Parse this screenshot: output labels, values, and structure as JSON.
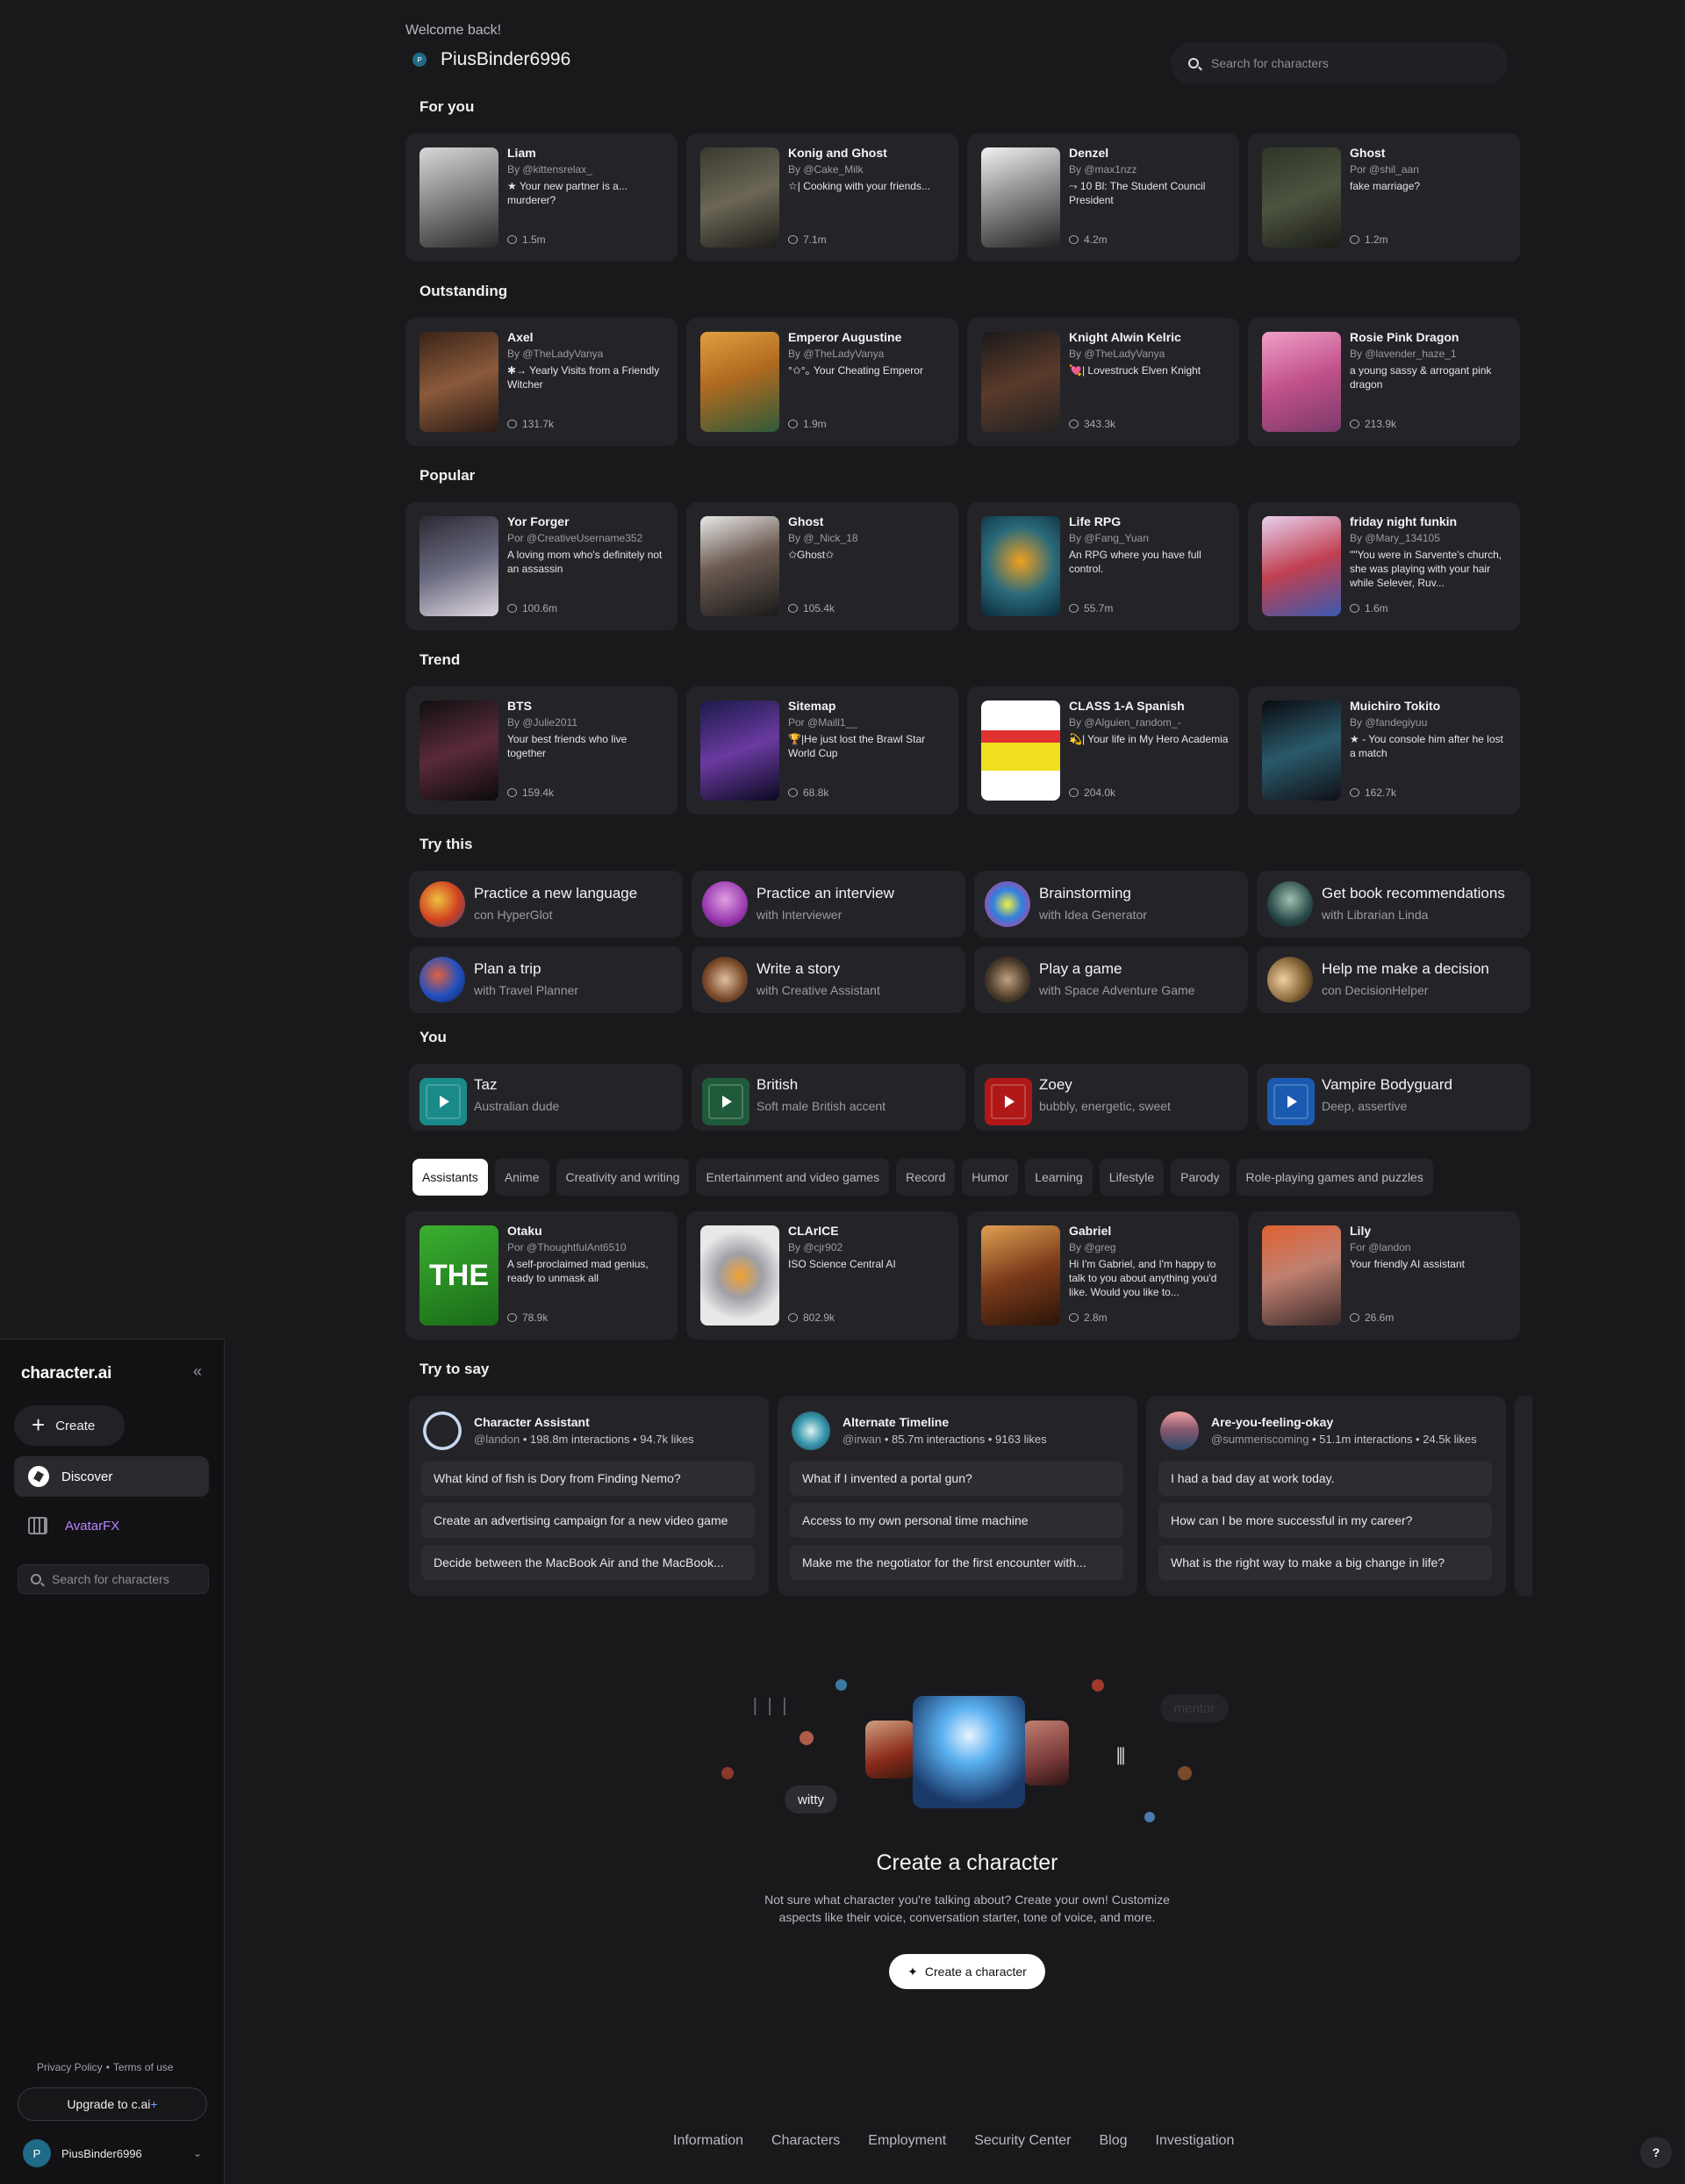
{
  "sidebar": {
    "logo": "character.ai",
    "collapse_icon": "«",
    "create_label": "Create",
    "nav": {
      "discover": "Discover",
      "avatarfx": "AvatarFX"
    },
    "search_placeholder": "Search for characters",
    "privacy": "Privacy Policy",
    "separator": "•",
    "terms": "Terms of use",
    "upgrade_prefix": "Upgrade to c.ai",
    "upgrade_plus": "+",
    "user_initial": "P",
    "user_name": "PiusBinder6996"
  },
  "header": {
    "welcome": "Welcome back!",
    "user_initial": "P",
    "user_name": "PiusBinder6996",
    "search_placeholder": "Search for characters"
  },
  "sections": {
    "for_you": {
      "title": "For you",
      "cards": [
        {
          "name": "Liam",
          "by": "By @kittensrelax_",
          "desc": "★ Your new partner is a... murderer?",
          "count": "1.5m",
          "thumb": "linear-gradient(160deg,#d8d8d8,#8a8a8a 45%,#2a2a2a)"
        },
        {
          "name": "Konig and Ghost",
          "by": "By @Cake_Milk",
          "desc": "☆| Cooking with your friends...",
          "count": "7.1m",
          "thumb": "linear-gradient(160deg,#3a3a30,#6b6656 50%,#1d1c18)"
        },
        {
          "name": "Denzel",
          "by": "By @max1nzz",
          "desc": "⤳ 10 Bl: The Student Council President",
          "count": "4.2m",
          "thumb": "linear-gradient(160deg,#f2f2f2,#9a9a9a 40%,#222)"
        },
        {
          "name": "Ghost",
          "by": "Por @shil_aan",
          "desc": "fake marriage?",
          "count": "1.2m",
          "thumb": "linear-gradient(160deg,#2f3528,#4d5340 50%,#1a1d16)"
        }
      ]
    },
    "outstanding": {
      "title": "Outstanding",
      "cards": [
        {
          "name": "Axel",
          "by": "By @TheLadyVanya",
          "desc": "✱→ Yearly Visits from a Friendly Witcher",
          "count": "131.7k",
          "thumb": "linear-gradient(160deg,#3a2418,#8a5a3a 50%,#2a1a14)"
        },
        {
          "name": "Emperor Augustine",
          "by": "By @TheLadyVanya",
          "desc": "°✩°｡ Your Cheating Emperor",
          "count": "1.9m",
          "thumb": "linear-gradient(160deg,#e0a040,#b06a20 45%,#2f5a3a)"
        },
        {
          "name": "Knight Alwin Kelric",
          "by": "By @TheLadyVanya",
          "desc": "💘| Lovestruck Elven Knight",
          "count": "343.3k",
          "thumb": "linear-gradient(160deg,#1a1a1a,#5a3a2a 50%,#222)"
        },
        {
          "name": "Rosie Pink Dragon",
          "by": "By @lavender_haze_1",
          "desc": "a young sassy & arrogant pink dragon",
          "count": "213.9k",
          "thumb": "linear-gradient(160deg,#f0a0c8,#c0508a 50%,#7a3a6a)"
        }
      ]
    },
    "popular": {
      "title": "Popular",
      "cards": [
        {
          "name": "Yor Forger",
          "by": "Por @CreativeUsername352",
          "desc": "A loving mom who's definitely not an assassin",
          "count": "100.6m",
          "thumb": "linear-gradient(160deg,#2a2a34,#6a6a80 50%,#e0d8e0)"
        },
        {
          "name": "Ghost",
          "by": "By @_Nick_18",
          "desc": "✩Ghost✩",
          "count": "105.4k",
          "thumb": "linear-gradient(160deg,#e8e8e8,#6a5a50 45%,#1a1a1a)"
        },
        {
          "name": "Life RPG",
          "by": "By @Fang_Yuan",
          "desc": "An RPG where you have full control.",
          "count": "55.7m",
          "thumb": "radial-gradient(circle at 50% 45%,#f0a020,#2a6a7a 50%,#0a2a3a)"
        },
        {
          "name": "friday night funkin",
          "by": "By @Mary_134105",
          "desc": "\"\"You were in Sarvente's church, she was playing with your hair while Selever, Ruv...",
          "count": "1.6m",
          "thumb": "linear-gradient(160deg,#e8d0f0,#c04050 50%,#3a5ab0)"
        }
      ]
    },
    "trend": {
      "title": "Trend",
      "cards": [
        {
          "name": "BTS",
          "by": "By @Julie2011",
          "desc": "Your best friends who live together",
          "count": "159.4k",
          "thumb": "linear-gradient(160deg,#101010,#5a2a3a 50%,#0a0a0a)"
        },
        {
          "name": "Sitemap",
          "by": "Por @Maill1__",
          "desc": "🏆|He just lost the Brawl Star World Cup",
          "count": "68.8k",
          "thumb": "linear-gradient(160deg,#1a1a4a,#6a3aa0 50%,#0a0a20)"
        },
        {
          "name": "CLASS 1-A Spanish",
          "by": "By @Alguien_random_-",
          "desc": "💫| Your life in My Hero Academia",
          "count": "204.0k",
          "thumb": "linear-gradient(180deg,#fff 0 30%,#e03030 30% 42%,#f0e020 42% 70%,#fff 70%)"
        },
        {
          "name": "Muichiro Tokito",
          "by": "By @fandegiyuu",
          "desc": "★ - You console him after he lost a match",
          "count": "162.7k",
          "thumb": "linear-gradient(160deg,#0a0a10,#2a5a6a 50%,#101018)"
        }
      ]
    },
    "try_this": {
      "title": "Try this",
      "items": [
        {
          "t1": "Practice a new language",
          "t2": "con HyperGlot",
          "bg": "radial-gradient(circle at 40% 40%,#f0c040,#d04020 55%,#2a4a8a)"
        },
        {
          "t1": "Practice an interview",
          "t2": "with Interviewer",
          "bg": "radial-gradient(circle at 50% 40%,#e0a0e0,#9a3ab0 60%,#3a1a4a)"
        },
        {
          "t1": "Brainstorming",
          "t2": "with Idea Generator",
          "bg": "radial-gradient(circle at 50% 50%,#f0f040,#3080e0 45%,#e03080)"
        },
        {
          "t1": "Get book recommendations",
          "t2": "with Librarian Linda",
          "bg": "radial-gradient(circle at 50% 40%,#a0c0b0,#2a4a4a 60%,#101818)"
        },
        {
          "t1": "Plan a trip",
          "t2": "with Travel Planner",
          "bg": "radial-gradient(circle at 40% 40%,#e06040,#2050c0 55%,#102050)"
        },
        {
          "t1": "Write a story",
          "t2": "with Creative Assistant",
          "bg": "radial-gradient(circle at 50% 50%,#e0c0a0,#7a4a2a 60%,#2a1a10)"
        },
        {
          "t1": "Play a game",
          "t2": "with Space Adventure Game",
          "bg": "radial-gradient(circle at 50% 50%,#c0a080,#4a3a2a 60%,#1a1410)"
        },
        {
          "t1": "Help me make a decision",
          "t2": "con DecisionHelper",
          "bg": "radial-gradient(circle at 35% 50%,#f0d0a0,#8a6a3a 55%,#1a1410)"
        }
      ]
    },
    "you": {
      "title": "You",
      "voices": [
        {
          "t1": "Taz",
          "t2": "Australian dude",
          "color": "#1a8a8a"
        },
        {
          "t1": "British",
          "t2": "Soft male British accent",
          "color": "#1f5a3a"
        },
        {
          "t1": "Zoey",
          "t2": "bubbly, energetic, sweet",
          "color": "#b01818"
        },
        {
          "t1": "Vampire Bodyguard",
          "t2": "Deep, assertive",
          "color": "#1a5ab0"
        }
      ]
    },
    "tags": [
      "Assistants",
      "Anime",
      "Creativity and writing",
      "Entertainment and video games",
      "Record",
      "Humor",
      "Learning",
      "Lifestyle",
      "Parody",
      "Role-playing games and puzzles"
    ],
    "assistants": {
      "cards": [
        {
          "name": "Otaku",
          "by": "Por @ThoughtfulAnt6510",
          "desc": "A self-proclaimed mad genius, ready to unmask all",
          "count": "78.9k",
          "thumb": "linear-gradient(160deg,#3ab030,#1a6a18)",
          "thumb_text": "THE"
        },
        {
          "name": "CLArICE",
          "by": "By @cjr902",
          "desc": "ISO Science Central AI",
          "count": "802.9k",
          "thumb": "radial-gradient(circle at 50% 50%,#f0a030,#a0a0a8 35%,#e8e8e8 70%)"
        },
        {
          "name": "Gabriel",
          "by": "By @greg",
          "desc": "Hi I'm Gabriel, and I'm happy to talk to you about anything you'd like. Would you like to...",
          "count": "2.8m",
          "thumb": "linear-gradient(160deg,#e0a050,#7a3a1a 50%,#2a1408)"
        },
        {
          "name": "Lily",
          "by": "For @landon",
          "desc": "Your friendly AI assistant",
          "count": "26.6m",
          "thumb": "linear-gradient(160deg,#e06030,#c08070 45%,#3a2a2a)"
        }
      ]
    },
    "try_to_say": {
      "title": "Try to say",
      "cards": [
        {
          "name": "Character Assistant",
          "handle": "@landon",
          "stats": " • 198.8m interactions • 94.7k likes",
          "avatar": "radial-gradient(circle,#242428 58%,#c8d8f0 60%,#c8d8f0 70%,#242428 72%)",
          "qs": [
            "What kind of fish is Dory from Finding Nemo?",
            "Create an advertising campaign for a new video game",
            "Decide between the MacBook Air and the MacBook..."
          ]
        },
        {
          "name": "Alternate Timeline",
          "handle": "@irwan",
          "stats": " • 85.7m interactions • 9163 likes",
          "avatar": "radial-gradient(circle at 50% 50%,#e0f0f0,#3a9ab0 50%,#1a3a4a)",
          "qs": [
            "What if I invented a portal gun?",
            "Access to my own personal time machine",
            "Make me the negotiator for the first encounter with..."
          ]
        },
        {
          "name": "Are-you-feeling-okay",
          "handle": "@summeriscoming",
          "stats": " • 51.1m interactions • 24.5k likes",
          "avatar": "linear-gradient(180deg,#f0a0a0,#8a5a70 45%,#2a4a6a)",
          "qs": [
            "I had a bad day at work today.",
            "How can I be more successful in my career?",
            "What is the right way to make a big change in life?"
          ]
        }
      ]
    }
  },
  "hero": {
    "pill_witty": "witty",
    "pill_mentor": "mentor",
    "title": "Create a character",
    "desc": "Not sure what character you're talking about? Create your own! Customize aspects like their voice, conversation starter, tone of voice, and more.",
    "button": "Create a character",
    "sparkle": "✦"
  },
  "footer": {
    "links": [
      "Information",
      "Characters",
      "Employment",
      "Security Center",
      "Blog",
      "Investigation"
    ],
    "help": "?"
  },
  "icons": {
    "chat_bubble": "chat-bubble-icon",
    "search": "search-icon",
    "play": "play-icon",
    "plus": "plus-icon"
  }
}
